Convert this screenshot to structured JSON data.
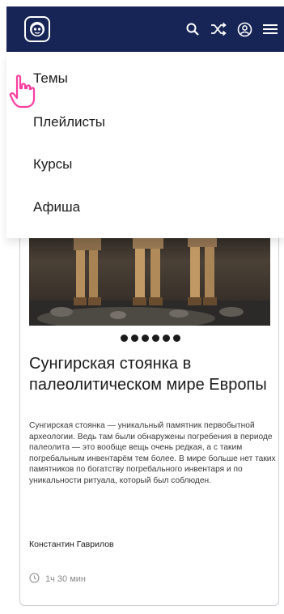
{
  "header": {
    "logo_icon": "monkey-logo-icon",
    "icons": [
      "search-icon",
      "shuffle-icon",
      "account-icon",
      "menu-icon"
    ],
    "background": "#172556"
  },
  "menu": {
    "items": [
      "Темы",
      "Плейлисты",
      "Курсы",
      "Афиша"
    ]
  },
  "card": {
    "title": "Сунгирская стоянка в палеолитическом мире Европы",
    "description": "Сунгирская стоянка — уникальный памятник первобытной археологии. Ведь там были обнаружены погребения в периоде палеолита — это вообще вещь очень редкая, а с таким погребальным инвентарём тем более. В мире больше нет таких памятников по богатству погребального инвентаря и по уникальности ритуала, который был соблюден.",
    "author": "Константин Гаврилов",
    "duration": "1ч 30 мин",
    "carousel_dots": 6
  }
}
